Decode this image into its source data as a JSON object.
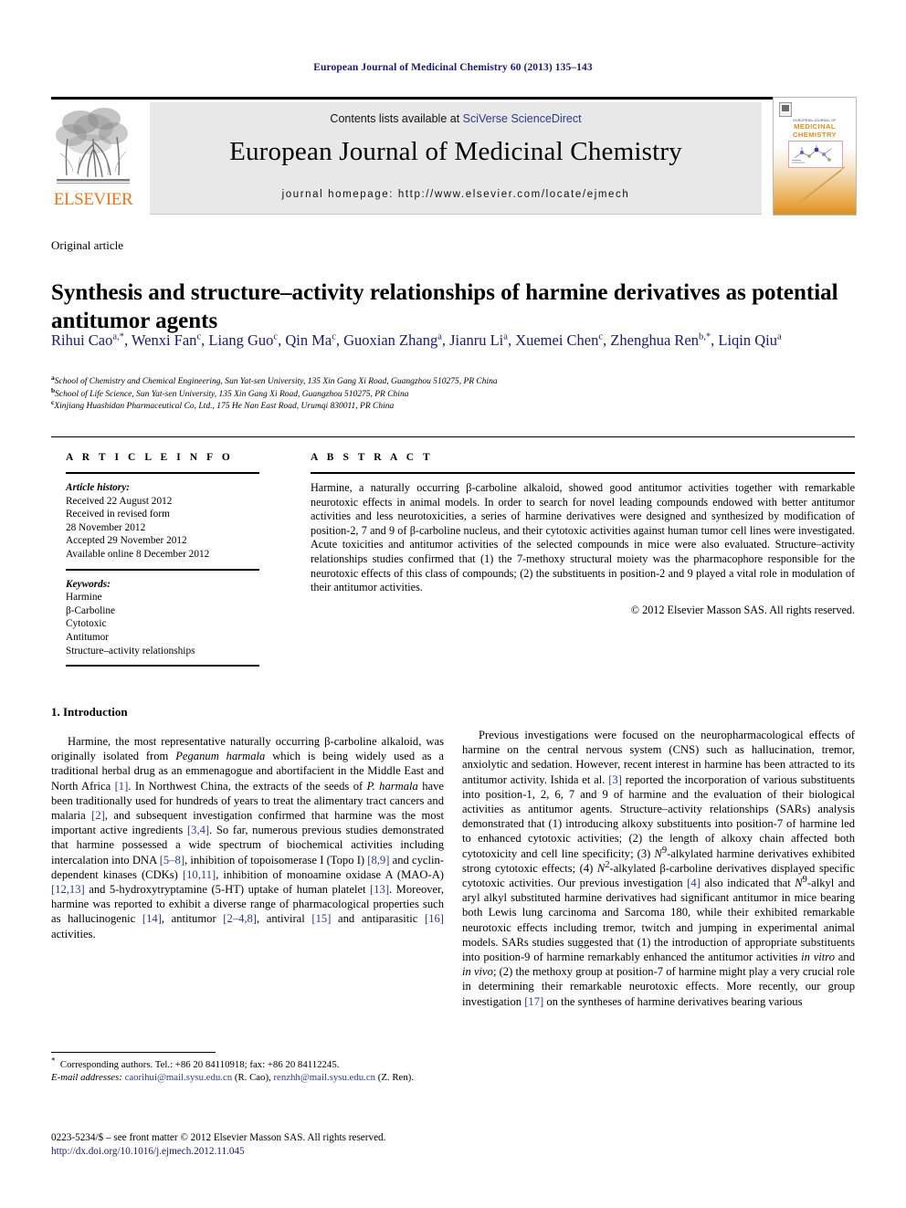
{
  "running_head": "European Journal of Medicinal Chemistry 60 (2013) 135–143",
  "masthead": {
    "contents_prefix": "Contents lists available at ",
    "sciencedirect": "SciVerse ScienceDirect",
    "journal_title": "European Journal of Medicinal Chemistry",
    "homepage": "journal homepage: http://www.elsevier.com/locate/ejmech",
    "publisher_wordmark": "ELSEVIER",
    "cover": {
      "kicker": "EUROPEAN JOURNAL OF",
      "line1": "MEDICINAL",
      "line2": "CHEMISTRY"
    },
    "accent_orange": "#E87722",
    "link_blue": "#2b3a8c"
  },
  "article": {
    "type": "Original article",
    "title": "Synthesis and structure–activity relationships of harmine derivatives as potential antitumor agents",
    "authors_line1": "Rihui Cao",
    "authors_html": "Rihui Cao<sup>a,*</sup>, Wenxi Fan<sup>c</sup>, Liang Guo<sup>c</sup>, Qin Ma<sup>c</sup>, Guoxian Zhang<sup>a</sup>, Jianru Li<sup>a</sup>, Xuemei Chen<sup>c</sup>, Zhenghua Ren<sup>b,*</sup>, Liqin Qiu<sup>a</sup>",
    "affiliations": [
      {
        "marker": "a",
        "text": "School of Chemistry and Chemical Engineering, Sun Yat-sen University, 135 Xin Gang Xi Road, Guangzhou 510275, PR China"
      },
      {
        "marker": "b",
        "text": "School of Life Science, Sun Yat-sen University, 135 Xin Gang Xi Road, Guangzhou 510275, PR China"
      },
      {
        "marker": "c",
        "text": "Xinjiang Huashidan Pharmaceutical Co, Ltd., 175 He Nan East Road, Urumqi 830011, PR China"
      }
    ]
  },
  "article_info": {
    "heading": "A R T I C L E   I N F O",
    "history_label": "Article history:",
    "history": [
      "Received 22 August 2012",
      "Received in revised form",
      "28 November 2012",
      "Accepted 29 November 2012",
      "Available online 8 December 2012"
    ],
    "keywords_label": "Keywords:",
    "keywords": [
      "Harmine",
      "β-Carboline",
      "Cytotoxic",
      "Antitumor",
      "Structure–activity relationships"
    ]
  },
  "abstract": {
    "heading": "A B S T R A C T",
    "text": "Harmine, a naturally occurring β-carboline alkaloid, showed good antitumor activities together with remarkable neurotoxic effects in animal models. In order to search for novel leading compounds endowed with better antitumor activities and less neurotoxicities, a series of harmine derivatives were designed and synthesized by modification of position-2, 7 and 9 of β-carboline nucleus, and their cytotoxic activities against human tumor cell lines were investigated. Acute toxicities and antitumor activities of the selected compounds in mice were also evaluated. Structure–activity relationships studies confirmed that (1) the 7-methoxy structural moiety was the pharmacophore responsible for the neurotoxic effects of this class of compounds; (2) the substituents in position-2 and 9 played a vital role in modulation of their antitumor activities.",
    "copyright": "© 2012 Elsevier Masson SAS. All rights reserved."
  },
  "body": {
    "section_heading": "1. Introduction",
    "left_paragraph_html": "Harmine, the most representative naturally occurring β-carboline alkaloid, was originally isolated from <i>Peganum harmala</i> which is being widely used as a traditional herbal drug as an emmenagogue and abortifacient in the Middle East and North Africa <span class=\"ref\">[1]</span>. In Northwest China, the extracts of the seeds of <i>P. harmala</i> have been traditionally used for hundreds of years to treat the alimentary tract cancers and malaria <span class=\"ref\">[2]</span>, and subsequent investigation confirmed that harmine was the most important active ingredients <span class=\"ref\">[3,4]</span>. So far, numerous previous studies demonstrated that harmine possessed a wide spectrum of biochemical activities including intercalation into DNA <span class=\"ref\">[5–8]</span>, inhibition of topoisomerase I (Topo I) <span class=\"ref\">[8,9]</span> and cyclin-dependent kinases (CDKs) <span class=\"ref\">[10,11]</span>, inhibition of monoamine oxidase A (MAO-A) <span class=\"ref\">[12,13]</span> and 5-hydroxytryptamine (5-HT) uptake of human platelet <span class=\"ref\">[13]</span>. Moreover, harmine was reported to exhibit a diverse range of pharmacological properties such as hallucinogenic <span class=\"ref\">[14]</span>, antitumor <span class=\"ref\">[2–4,8]</span>, antiviral <span class=\"ref\">[15]</span> and antiparasitic <span class=\"ref\">[16]</span> activities.",
    "right_paragraph_html": "Previous investigations were focused on the neuropharmacological effects of harmine on the central nervous system (CNS) such as hallucination, tremor, anxiolytic and sedation. However, recent interest in harmine has been attracted to its antitumor activity. Ishida et al. <span class=\"ref\">[3]</span> reported the incorporation of various substituents into position-1, 2, 6, 7 and 9 of harmine and the evaluation of their biological activities as antitumor agents. Structure–activity relationships (SARs) analysis demonstrated that (1) introducing alkoxy substituents into position-7 of harmine led to enhanced cytotoxic activities; (2) the length of alkoxy chain affected both cytotoxicity and cell line specificity; (3) <i>N</i><sup>9</sup>-alkylated harmine derivatives exhibited strong cytotoxic effects; (4) <i>N</i><sup>2</sup>-alkylated β-carboline derivatives displayed specific cytotoxic activities. Our previous investigation <span class=\"ref\">[4]</span> also indicated that <i>N</i><sup>9</sup>-alkyl and aryl alkyl substituted harmine derivatives had significant antitumor in mice bearing both Lewis lung carcinoma and Sarcoma 180, while their exhibited remarkable neurotoxic effects including tremor, twitch and jumping in experimental animal models. SARs studies suggested that (1) the introduction of appropriate substituents into position-9 of harmine remarkably enhanced the antitumor activities <i>in vitro</i> and <i>in vivo</i>; (2) the methoxy group at position-7 of harmine might play a very crucial role in determining their remarkable neurotoxic effects. More recently, our group investigation <span class=\"ref\">[17]</span> on the syntheses of harmine derivatives bearing various"
  },
  "footnotes": {
    "corresponding_html": "<sup>*</sup>&nbsp; Corresponding authors. Tel.: +86 20 84110918; fax: +86 20 84112245.",
    "emails_html": "<span class=\"ital\">E-mail addresses:</span> <span class=\"mail\">caorihui@mail.sysu.edu.cn</span> (R. Cao), <span class=\"mail\">renzhh@mail.sysu.edu.cn</span> (Z. Ren)."
  },
  "colophon": {
    "line1": "0223-5234/$ – see front matter © 2012 Elsevier Masson SAS. All rights reserved.",
    "doi": "http://dx.doi.org/10.1016/j.ejmech.2012.11.045"
  }
}
